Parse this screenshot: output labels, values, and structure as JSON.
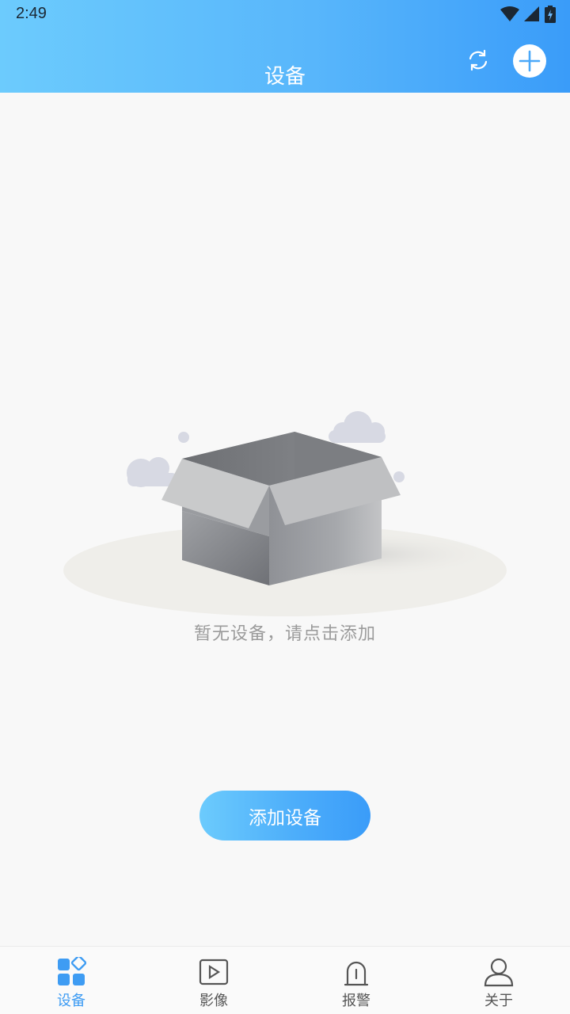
{
  "status_bar": {
    "time": "2:49"
  },
  "header": {
    "title": "设备"
  },
  "empty_state": {
    "message": "暂无设备，请点击添加"
  },
  "actions": {
    "add_device_label": "添加设备"
  },
  "tabs": [
    {
      "label": "设备",
      "icon": "devices-grid-icon",
      "active": true
    },
    {
      "label": "影像",
      "icon": "video-play-icon",
      "active": false
    },
    {
      "label": "报警",
      "icon": "alarm-bell-icon",
      "active": false
    },
    {
      "label": "关于",
      "icon": "person-icon",
      "active": false
    }
  ],
  "colors": {
    "accent": "#3e9cf3",
    "header_start": "#6ccbfd",
    "header_end": "#3a9cf9"
  }
}
